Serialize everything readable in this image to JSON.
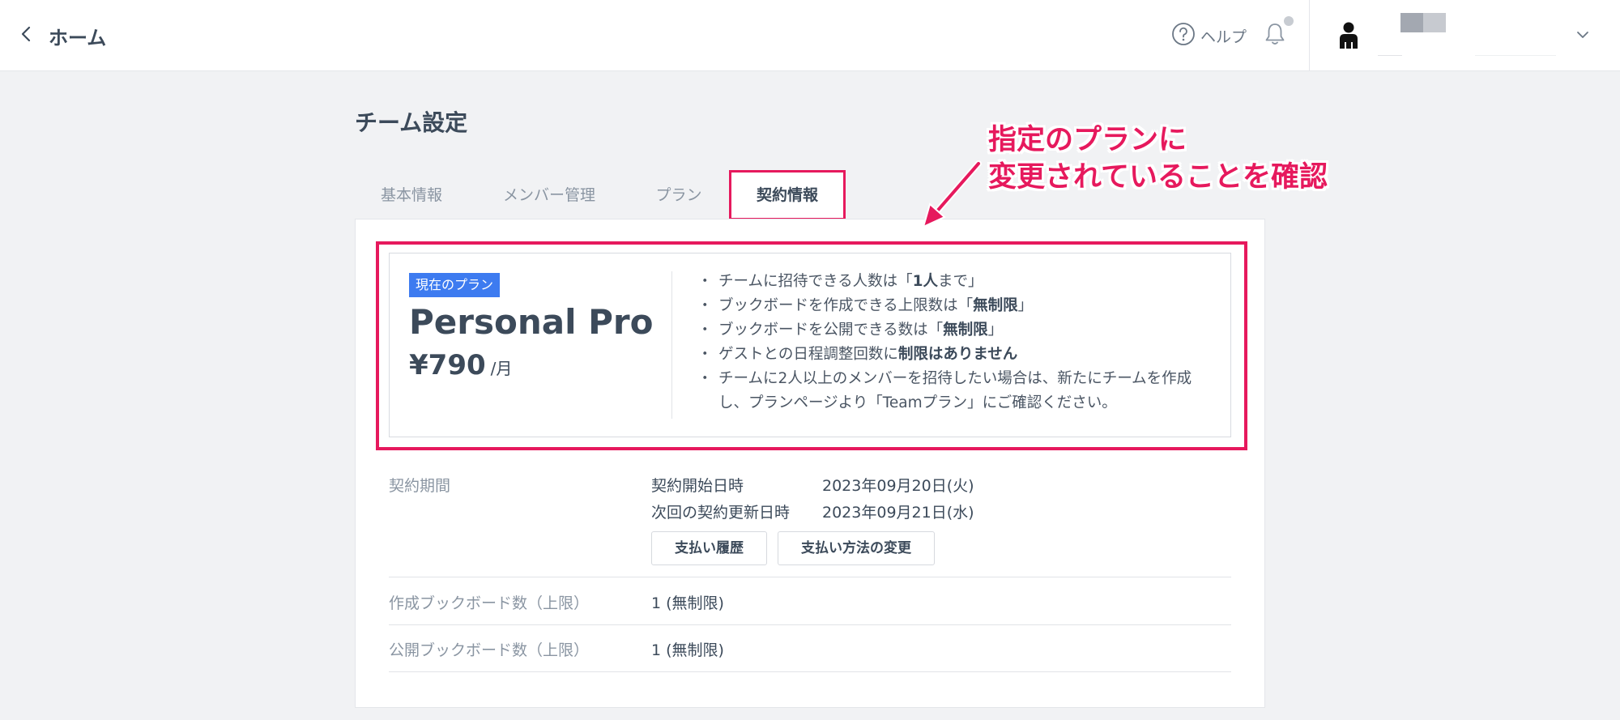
{
  "header": {
    "back_label": "ホーム",
    "help_label": "ヘルプ"
  },
  "page": {
    "title": "チーム設定"
  },
  "tabs": [
    {
      "label": "基本情報",
      "active": false
    },
    {
      "label": "メンバー管理",
      "active": false
    },
    {
      "label": "プラン",
      "active": false
    },
    {
      "label": "契約情報",
      "active": true
    }
  ],
  "plan": {
    "badge": "現在のプラン",
    "name": "Personal Pro",
    "price": "¥790",
    "price_unit": "/月",
    "features": [
      {
        "pre": "チームに招待できる人数は「",
        "bold": "1人",
        "post": "まで」"
      },
      {
        "pre": "ブックボードを作成できる上限数は「",
        "bold": "無制限",
        "post": "」"
      },
      {
        "pre": "ブックボードを公開できる数は「",
        "bold": "無制限",
        "post": "」"
      },
      {
        "pre": "ゲストとの日程調整回数に",
        "bold": "制限はありません",
        "post": ""
      },
      {
        "pre": "チームに2人以上のメンバーを招待したい場合は、新たにチームを作成し、プランページより「Teamプラン」にご確認ください。",
        "bold": "",
        "post": ""
      }
    ]
  },
  "contract": {
    "period_label": "契約期間",
    "start_key": "契約開始日時",
    "start_value": "2023年09月20日(火)",
    "renew_key": "次回の契約更新日時",
    "renew_value": "2023年09月21日(水)",
    "history_button": "支払い履歴",
    "payment_button": "支払い方法の変更",
    "created_label": "作成ブックボード数（上限）",
    "created_value": "1 (無制限)",
    "published_label": "公開ブックボード数（上限）",
    "published_value": "1 (無制限)"
  },
  "annotation": {
    "line1": "指定のプランに",
    "line2": "変更されていることを確認"
  },
  "colors": {
    "accent": "#e6195d",
    "badge": "#3d7bf0",
    "text": "#3c4a5a",
    "muted": "#8a95a2"
  }
}
